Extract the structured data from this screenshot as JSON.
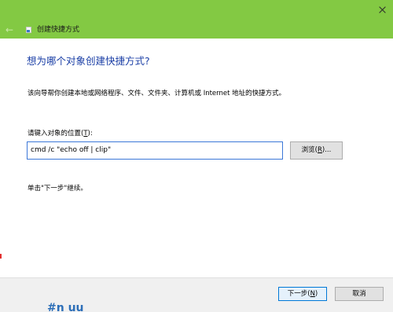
{
  "window": {
    "close_label": "✕",
    "back_icon": "back-arrow-icon",
    "title": "创建快捷方式"
  },
  "main": {
    "heading": "想为哪个对象创建快捷方式?",
    "description": "该向导帮你创建本地或网络程序、文件、文件夹、计算机或 Internet 地址的快捷方式。",
    "field_label_prefix": "请键入对象的位置(",
    "field_label_key": "T",
    "field_label_suffix": "):",
    "location_value": "cmd /c \"echo off | clip\"",
    "browse_prefix": "浏览(",
    "browse_key": "R",
    "browse_suffix": ")...",
    "instruction": "单击\"下一步\"继续。"
  },
  "footer": {
    "next_prefix": "下一步(",
    "next_key": "N",
    "next_suffix": ")",
    "cancel_label": "取消"
  },
  "background": {
    "peek_text": "#n uu"
  },
  "colors": {
    "titlebar": "#83c943",
    "heading": "#1b3fa6",
    "input_border": "#3c78d8",
    "button_focus_border": "#0078d7"
  }
}
